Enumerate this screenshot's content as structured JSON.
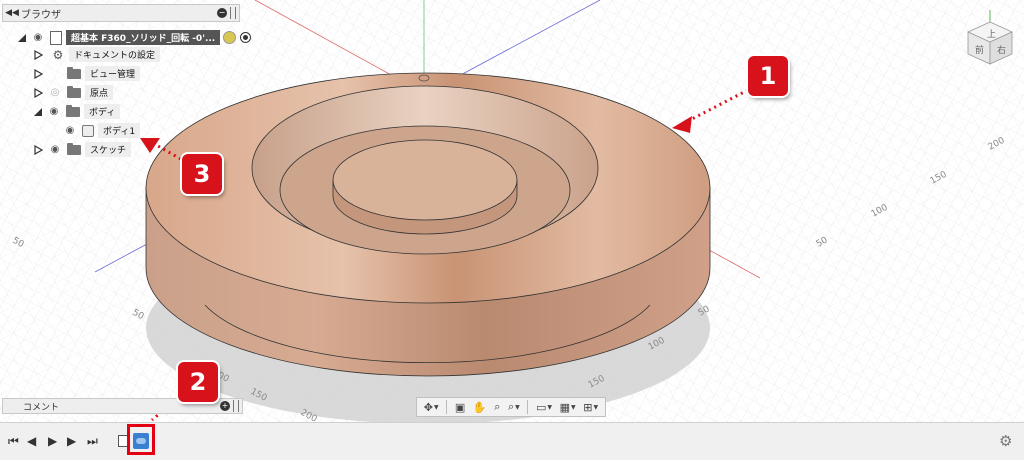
{
  "browser": {
    "collapse_icon": "double-chevron-left-icon",
    "title": "ブラウザ",
    "root_label": "超基本 F360_ソリッド_回転 -0'...",
    "items": [
      {
        "label": "ドキュメントの設定",
        "icon": "gear-icon",
        "expanded": false,
        "visible_toggle": false
      },
      {
        "label": "ビュー管理",
        "icon": "folder-icon",
        "expanded": false,
        "visible_toggle": false
      },
      {
        "label": "原点",
        "icon": "folder-icon",
        "expanded": false,
        "visible_toggle": true,
        "eye": "eye-hidden"
      },
      {
        "label": "ボディ",
        "icon": "folder-icon",
        "expanded": true,
        "visible_toggle": true,
        "eye": "eye"
      },
      {
        "label": "ボディ1",
        "icon": "body-icon",
        "expanded": false,
        "visible_toggle": true,
        "eye": "eye"
      },
      {
        "label": "スケッチ",
        "icon": "folder-icon",
        "expanded": false,
        "visible_toggle": true,
        "eye": "eye"
      }
    ]
  },
  "comments": {
    "title": "コメント"
  },
  "grid_labels": {
    "right_axis": [
      "200",
      "150",
      "100",
      "50"
    ],
    "left_axis": [
      "50"
    ],
    "bottom_left": [
      "50",
      "100",
      "150",
      "200"
    ],
    "bottom_right": [
      "50",
      "100",
      "150"
    ]
  },
  "viewcube": {
    "top_face": "上",
    "front_face": "前",
    "right_face": "右"
  },
  "nav_toolbar": {
    "tools": [
      "orbit-icon",
      "look-at-icon",
      "pan-icon",
      "zoom-icon",
      "fit-icon",
      "display-settings-icon",
      "grid-settings-icon",
      "viewports-icon"
    ]
  },
  "timeline": {
    "buttons": [
      "go-to-start-icon",
      "step-back-icon",
      "play-icon",
      "step-forward-icon",
      "go-to-end-icon"
    ],
    "settings_icon": "gear-icon"
  },
  "callouts": [
    "1",
    "2",
    "3"
  ],
  "colors": {
    "body_fill": "#d9a98a",
    "body_dark": "#b88466",
    "accent_red": "#d8121b",
    "timeline_feature": "#3b7fd1"
  }
}
